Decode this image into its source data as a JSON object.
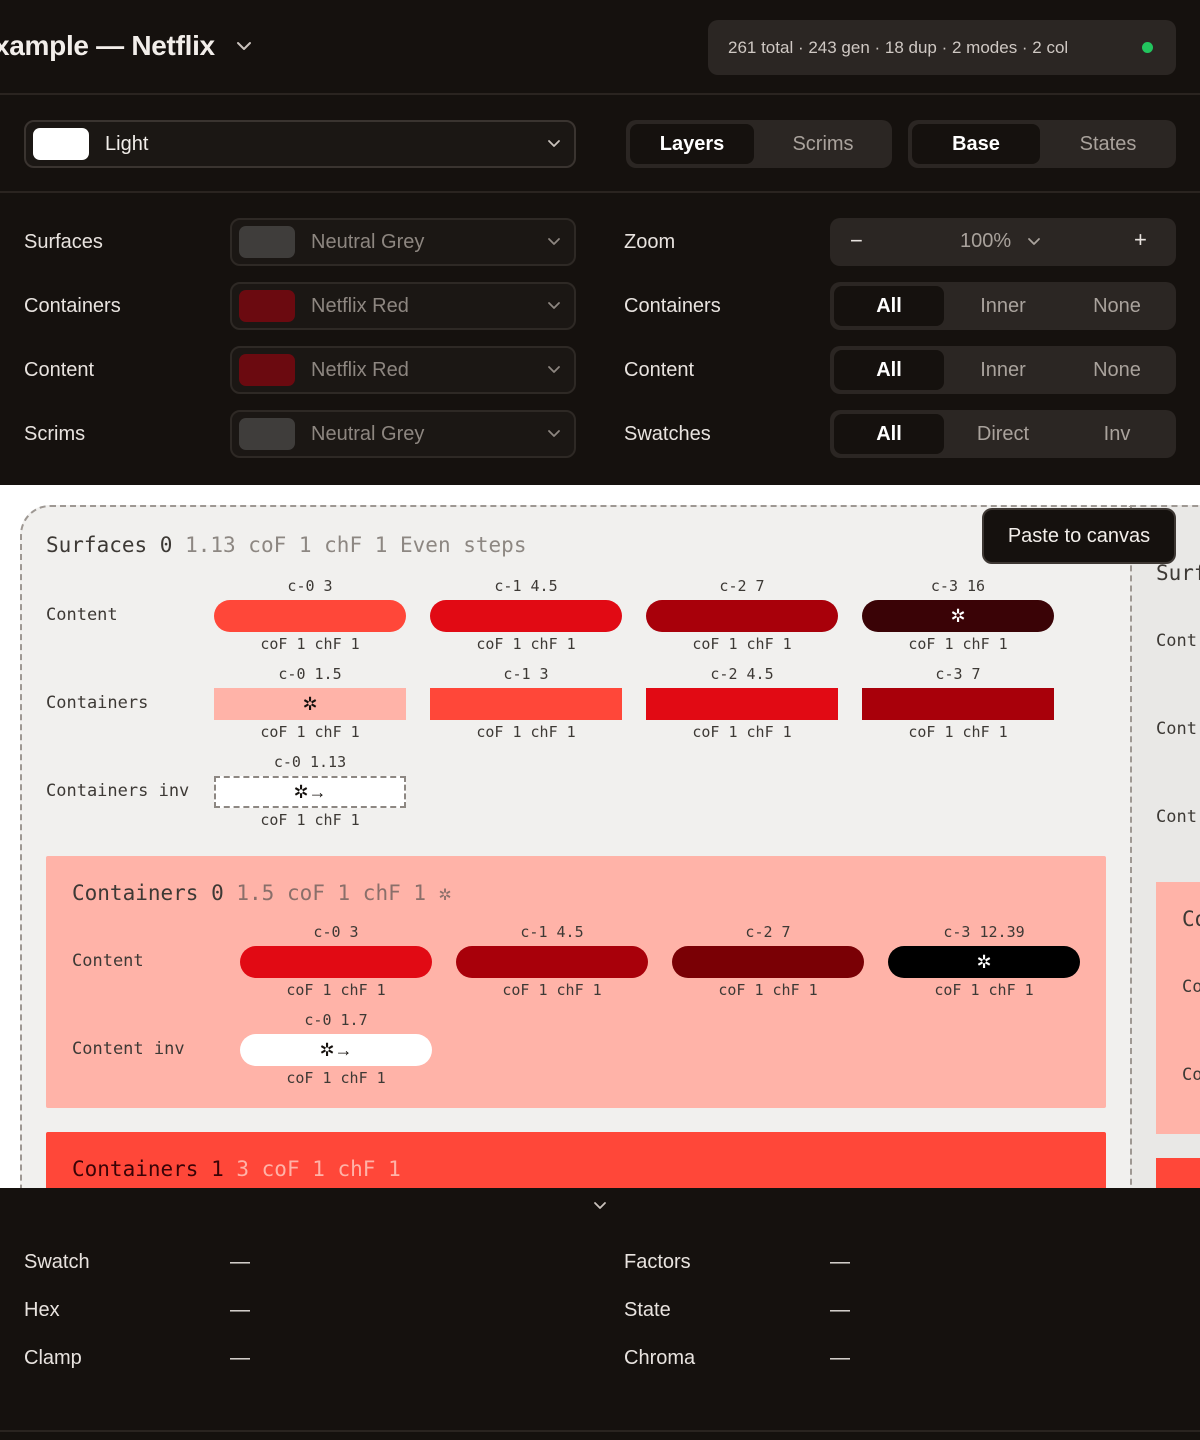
{
  "header": {
    "title": "xample — Netflix",
    "stats": "261 total · 243 gen · 18 dup · 2 modes · 2 col",
    "status_color": "#22c55e"
  },
  "mode": {
    "selected": "Light",
    "swatch_color": "#ffffff",
    "view_tabs": [
      "Layers",
      "Scrims"
    ],
    "view_active": "Layers",
    "state_tabs": [
      "Base",
      "States"
    ],
    "state_active": "Base"
  },
  "controls": {
    "surfaces": {
      "label": "Surfaces",
      "value": "Neutral Grey",
      "color": "#3f3d3b"
    },
    "containers": {
      "label": "Containers",
      "value": "Netflix Red",
      "color": "#6b0a10"
    },
    "content": {
      "label": "Content",
      "value": "Netflix Red",
      "color": "#6b0a10"
    },
    "scrims": {
      "label": "Scrims",
      "value": "Neutral Grey",
      "color": "#3f3d3b"
    },
    "zoom": {
      "label": "Zoom",
      "minus": "−",
      "value": "100%",
      "plus": "+"
    },
    "containers_filter": {
      "label": "Containers",
      "options": [
        "All",
        "Inner",
        "None"
      ],
      "active": "All"
    },
    "content_filter": {
      "label": "Content",
      "options": [
        "All",
        "Inner",
        "None"
      ],
      "active": "All"
    },
    "swatches_filter": {
      "label": "Swatches",
      "options": [
        "All",
        "Direct",
        "Inv"
      ],
      "active": "All"
    }
  },
  "canvas": {
    "paste_button": "Paste to canvas",
    "surfaces0": {
      "name": "Surfaces 0",
      "meta": "1.13 coF 1 chF 1 Even steps",
      "content_label": "Content",
      "content": [
        {
          "top": "c-0 3",
          "bottom": "coF 1 chF 1",
          "color": "#ff4739",
          "glyph": ""
        },
        {
          "top": "c-1 4.5",
          "bottom": "coF 1 chF 1",
          "color": "#e10a14",
          "glyph": ""
        },
        {
          "top": "c-2 7",
          "bottom": "coF 1 chF 1",
          "color": "#a8000a",
          "glyph": ""
        },
        {
          "top": "c-3 16",
          "bottom": "coF 1 chF 1",
          "color": "#3a0306",
          "glyph": "✲"
        }
      ],
      "containers_label": "Containers",
      "containers": [
        {
          "top": "c-0 1.5",
          "bottom": "coF 1 chF 1",
          "color": "#ffb3a8",
          "glyph": "✲"
        },
        {
          "top": "c-1 3",
          "bottom": "coF 1 chF 1",
          "color": "#ff4739",
          "glyph": ""
        },
        {
          "top": "c-2 4.5",
          "bottom": "coF 1 chF 1",
          "color": "#e10a14",
          "glyph": ""
        },
        {
          "top": "c-3 7",
          "bottom": "coF 1 chF 1",
          "color": "#a8000a",
          "glyph": ""
        }
      ],
      "containers_inv_label": "Containers inv",
      "containers_inv": [
        {
          "top": "c-0 1.13",
          "bottom": "coF 1 chF 1",
          "color": "#ffffff",
          "glyph": "✲→"
        }
      ]
    },
    "containers0": {
      "name": "Containers 0",
      "meta": "1.5 coF 1 chF 1 ✲",
      "content_label": "Content",
      "content": [
        {
          "top": "c-0 3",
          "bottom": "coF 1 chF 1",
          "color": "#e10a14",
          "glyph": ""
        },
        {
          "top": "c-1 4.5",
          "bottom": "coF 1 chF 1",
          "color": "#a8000a",
          "glyph": ""
        },
        {
          "top": "c-2 7",
          "bottom": "coF 1 chF 1",
          "color": "#7a0005",
          "glyph": ""
        },
        {
          "top": "c-3 12.39",
          "bottom": "coF 1 chF 1",
          "color": "#000000",
          "glyph": "✲"
        }
      ],
      "content_inv_label": "Content inv",
      "content_inv": [
        {
          "top": "c-0 1.7",
          "bottom": "coF 1 chF 1",
          "color": "#ffffff",
          "glyph": "✲→"
        }
      ]
    },
    "containers1": {
      "name": "Containers 1",
      "meta": "3 coF 1 chF 1"
    },
    "right_column": {
      "title": "Surf",
      "labels": [
        "Cont",
        "Cont",
        "Cont"
      ],
      "block_title": "Co",
      "block_labels": [
        "Co",
        "Co"
      ]
    }
  },
  "inspector": {
    "swatch": {
      "label": "Swatch",
      "value": "—"
    },
    "hex": {
      "label": "Hex",
      "value": "—"
    },
    "clamp": {
      "label": "Clamp",
      "value": "—"
    },
    "factors": {
      "label": "Factors",
      "value": "—"
    },
    "state": {
      "label": "State",
      "value": "—"
    },
    "chroma": {
      "label": "Chroma",
      "value": "—"
    }
  }
}
